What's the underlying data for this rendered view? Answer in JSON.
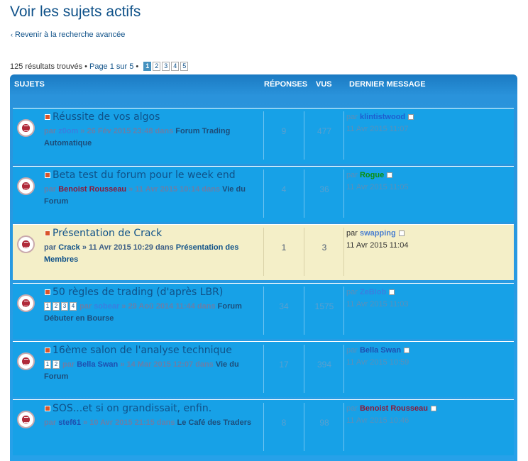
{
  "page": {
    "title": "Voir les sujets actifs",
    "back_link": "Revenir à la recherche avancée"
  },
  "pagination": {
    "results": "125 résultats trouvés",
    "page_label": "Page 1 sur 5",
    "pages": [
      "1",
      "2",
      "3",
      "4",
      "5"
    ],
    "current": "1"
  },
  "table": {
    "headers": {
      "topics": "SUJETS",
      "replies": "RÉPONSES",
      "views": "VUS",
      "last_post": "DERNIER MESSAGE"
    },
    "rows": [
      {
        "title": "Réussite de vos algos",
        "by": "par",
        "author": "z0om",
        "date": "» 26 Fév 2015 23:48 dans",
        "forum": "Forum Trading Automatique",
        "replies": "9",
        "views": "477",
        "last_by": "par",
        "last_user": "klintistwood",
        "last_user_color": "#1e5ecf",
        "last_date": "11 Avr 2015 11:07",
        "author_color": "#3a7fe0",
        "highlight": false,
        "minipages": []
      },
      {
        "title": "Beta test du forum pour le week end",
        "by": "par",
        "author": "Benoist Rousseau",
        "date": "» 11 Avr 2015 10:14 dans",
        "forum": "Vie du Forum",
        "replies": "4",
        "views": "36",
        "last_by": "par",
        "last_user": "Rogue",
        "last_user_color": "#0b8f0b",
        "last_date": "11 Avr 2015 11:05",
        "author_color": "#8b1a3a",
        "highlight": false,
        "minipages": []
      },
      {
        "title": "Présentation de Crack",
        "by": "par",
        "author": "Crack",
        "date": "» 11 Avr 2015 10:29 dans",
        "forum": "Présentation des Membres",
        "replies": "1",
        "views": "3",
        "last_by": "par",
        "last_user": "swapping",
        "last_user_color": "#4a7fd0",
        "last_date": "11 Avr 2015 11:04",
        "author_color": "#105289",
        "highlight": true,
        "minipages": []
      },
      {
        "title": "50 règles de trading (d'après LBR)",
        "by": "par",
        "author": "sobear",
        "date": "» 29 Aoû 2014 11:44 dans",
        "forum": "Forum Débuter en Bourse",
        "replies": "34",
        "views": "1575",
        "last_by": "par",
        "last_user": "ZeBlob",
        "last_user_color": "#3a7fe0",
        "last_date": "11 Avr 2015 11:03",
        "author_color": "#3a7fe0",
        "highlight": false,
        "minipages": [
          "1",
          "2",
          "3",
          "4"
        ]
      },
      {
        "title": "16ème salon de l'analyse technique",
        "by": "par",
        "author": "Bella Swan",
        "date": "» 14 Mar 2015 12:07 dans",
        "forum": "Vie du Forum",
        "replies": "17",
        "views": "394",
        "last_by": "par",
        "last_user": "Bella Swan",
        "last_user_color": "#1e4fb0",
        "last_date": "11 Avr 2015 10:59",
        "author_color": "#1e4fb0",
        "highlight": false,
        "minipages": [
          "1",
          "2"
        ]
      },
      {
        "title": "SOS...et si on grandissait, enfin.",
        "by": "par",
        "author": "stef61",
        "date": "» 10 Avr 2015 21:15 dans",
        "forum": "Le Café des Traders",
        "replies": "8",
        "views": "98",
        "last_by": "par",
        "last_user": "Benoist Rousseau",
        "last_user_color": "#8b1a3a",
        "last_date": "11 Avr 2015 10:46",
        "author_color": "#1e4fb0",
        "highlight": false,
        "minipages": []
      }
    ]
  }
}
